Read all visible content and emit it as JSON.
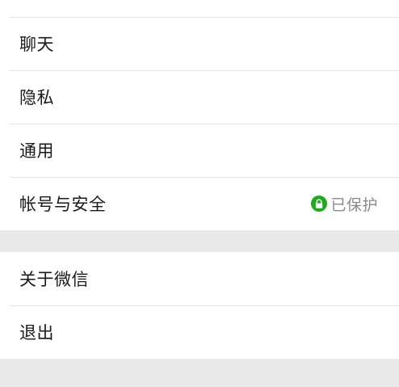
{
  "settings": {
    "group1": [
      {
        "label": "聊天"
      },
      {
        "label": "隐私"
      },
      {
        "label": "通用"
      },
      {
        "label": "帐号与安全",
        "status": "已保护"
      }
    ],
    "group2": [
      {
        "label": "关于微信"
      },
      {
        "label": "退出"
      }
    ]
  },
  "colors": {
    "accent_green": "#1aad19",
    "background": "#e9e9e9",
    "row_background": "#ffffff",
    "divider": "#e3e3e3",
    "secondary_text": "#8a8a8a"
  },
  "icons": {
    "protected_status": "lock-icon"
  }
}
